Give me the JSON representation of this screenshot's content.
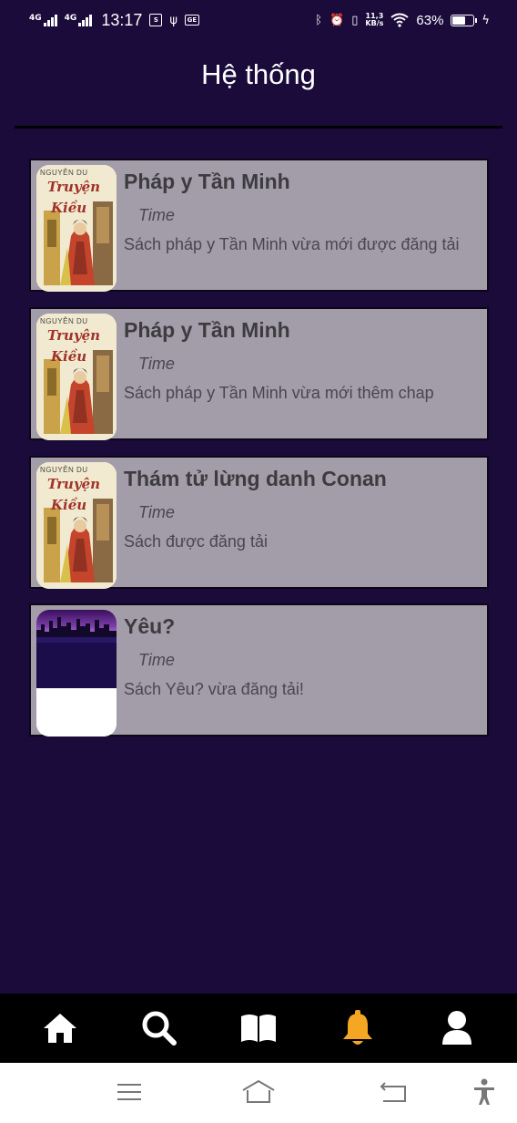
{
  "status_bar": {
    "net1": "4G",
    "net2": "4G",
    "time": "13:17",
    "net_speed_value": "11,3",
    "net_speed_unit": "KB/s",
    "battery_percent": "63%",
    "battery_level": 0.63,
    "icons": [
      "shopee-icon",
      "usb-icon",
      "ge-icon",
      "bluetooth-icon",
      "alarm-icon",
      "vibrate-icon",
      "wifi-icon",
      "battery-icon",
      "charging-icon"
    ]
  },
  "header": {
    "title": "Hệ thống"
  },
  "notifications": [
    {
      "title": "Pháp y Tần Minh",
      "time": "Time",
      "message": "Sách pháp y Tần Minh vừa mới được đăng tải",
      "cover": "truyen-kieu"
    },
    {
      "title": "Pháp y Tần Minh",
      "time": "Time",
      "message": "Sách pháp y Tần Minh vừa mới thêm chap",
      "cover": "truyen-kieu"
    },
    {
      "title": "Thám tử lừng danh Conan",
      "time": "Time",
      "message": "Sách được đăng tải",
      "cover": "truyen-kieu"
    },
    {
      "title": "Yêu?",
      "time": "Time",
      "message": "Sách Yêu? vừa đăng tải!",
      "cover": "city-night"
    }
  ],
  "cover_text": {
    "author": "NGUYỄN DU",
    "title_line1": "Truyện",
    "title_line2": "Kiều"
  },
  "bottom_nav": {
    "items": [
      {
        "name": "home",
        "icon": "home-icon",
        "active": false
      },
      {
        "name": "search",
        "icon": "search-icon",
        "active": false
      },
      {
        "name": "library",
        "icon": "book-open-icon",
        "active": false
      },
      {
        "name": "notifications",
        "icon": "bell-icon",
        "active": true
      },
      {
        "name": "profile",
        "icon": "user-icon",
        "active": false
      }
    ],
    "active_color": "#f5a623",
    "inactive_color": "#ffffff"
  },
  "colors": {
    "background": "#1a0b3b",
    "card": "#a39ca9"
  }
}
